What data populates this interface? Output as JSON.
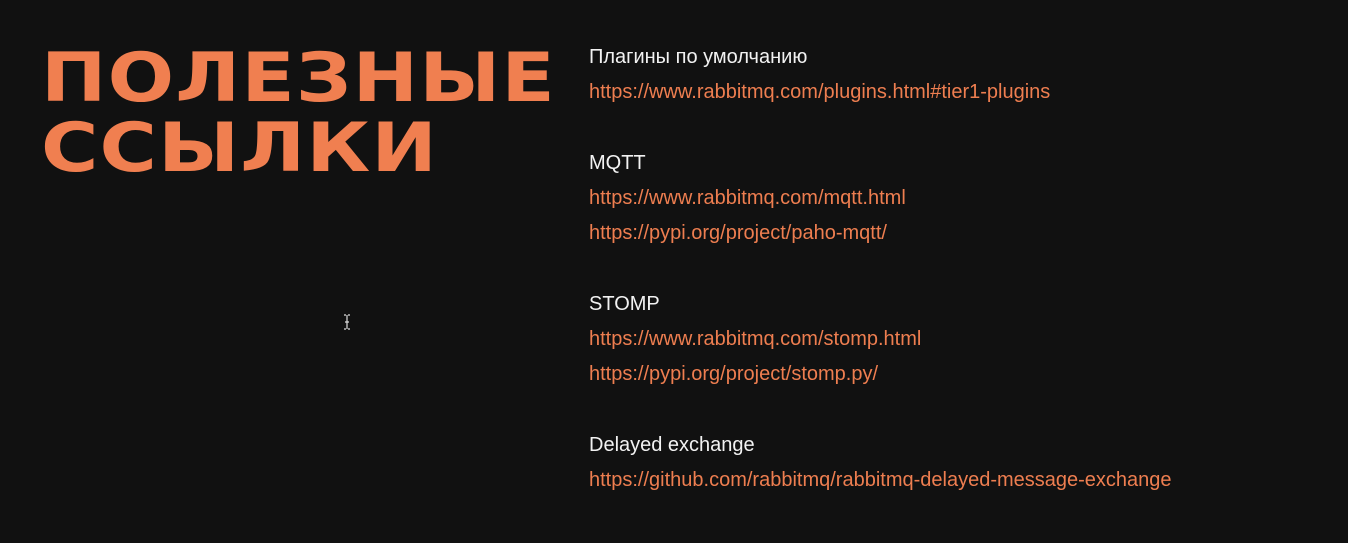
{
  "slide": {
    "title_lines": [
      "ПОЛЕЗНЫЕ",
      "ССЫЛКИ"
    ],
    "groups": [
      {
        "heading": "Плагины по умолчанию",
        "links": [
          "https://www.rabbitmq.com/plugins.html#tier1-plugins"
        ]
      },
      {
        "heading": "MQTT",
        "links": [
          "https://www.rabbitmq.com/mqtt.html",
          "https://pypi.org/project/paho-mqtt/"
        ]
      },
      {
        "heading": "STOMP",
        "links": [
          "https://www.rabbitmq.com/stomp.html",
          "https://pypi.org/project/stomp.py/"
        ]
      },
      {
        "heading": "Delayed exchange",
        "links": [
          "https://github.com/rabbitmq/rabbitmq-delayed-message-exchange"
        ]
      }
    ]
  },
  "colors": {
    "background": "#111111",
    "accent": "#F07F50",
    "heading_text": "#F2F2F2"
  },
  "icons": {
    "cursor": "text-cursor-icon"
  }
}
